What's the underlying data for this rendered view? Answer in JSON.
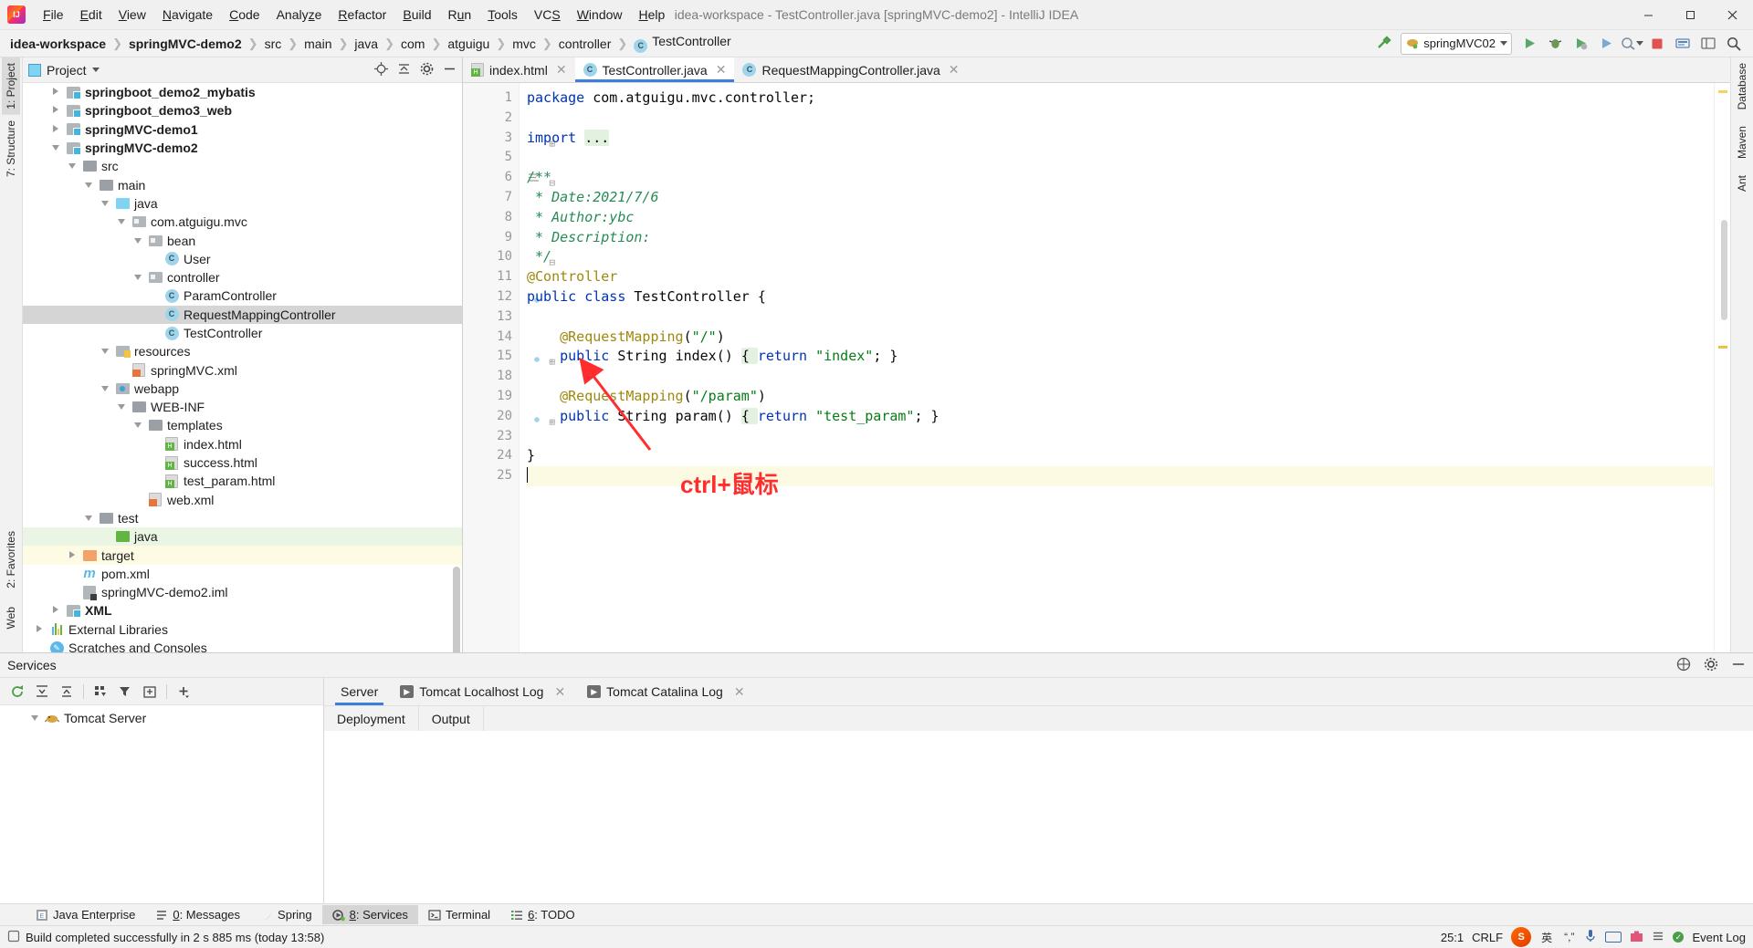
{
  "window": {
    "title": "idea-workspace - TestController.java [springMVC-demo2] - IntelliJ IDEA",
    "minimize": "—",
    "maximize": "❐",
    "close": "✕"
  },
  "menubar": [
    {
      "label": "File"
    },
    {
      "label": "Edit"
    },
    {
      "label": "View"
    },
    {
      "label": "Navigate"
    },
    {
      "label": "Code"
    },
    {
      "label": "Analyze"
    },
    {
      "label": "Refactor"
    },
    {
      "label": "Build"
    },
    {
      "label": "Run"
    },
    {
      "label": "Tools"
    },
    {
      "label": "VCS"
    },
    {
      "label": "Window"
    },
    {
      "label": "Help"
    }
  ],
  "breadcrumbs": [
    {
      "label": "idea-workspace",
      "bold": false
    },
    {
      "label": "springMVC-demo2",
      "bold": true
    },
    {
      "label": "src",
      "bold": false
    },
    {
      "label": "main",
      "bold": false
    },
    {
      "label": "java",
      "bold": false
    },
    {
      "label": "com",
      "bold": false
    },
    {
      "label": "atguigu",
      "bold": false
    },
    {
      "label": "mvc",
      "bold": false
    },
    {
      "label": "controller",
      "bold": false
    },
    {
      "label": "TestController",
      "bold": false,
      "icon": "class-icon"
    }
  ],
  "toolbar": {
    "build_hammer_icon": "hammer-icon",
    "run_config_name": "springMVC02",
    "run_icon": "run-icon",
    "debug_icon": "debug-icon",
    "coverage_icon": "coverage-icon",
    "profile_icon": "profile-icon",
    "attach_icon": "attach-icon",
    "stop_icon": "stop-icon",
    "updates_icon": "updates-icon",
    "layout_icon": "layout-icon",
    "search_icon": "search-icon"
  },
  "left_strip": [
    {
      "label": "1: Project",
      "selected": true,
      "name": "project-tool-tab"
    },
    {
      "label": "7: Structure",
      "selected": false,
      "name": "structure-tool-tab"
    },
    {
      "label": "2: Favorites",
      "selected": false,
      "name": "favorites-tool-tab"
    },
    {
      "label": "Web",
      "selected": false,
      "name": "web-tool-tab"
    }
  ],
  "right_strip": [
    {
      "label": "Database",
      "name": "database-tool-tab"
    },
    {
      "label": "Maven",
      "name": "maven-tool-tab"
    },
    {
      "label": "Ant",
      "name": "ant-tool-tab"
    }
  ],
  "project_panel": {
    "title": "Project",
    "dropdown_icon": "chevron-down-icon",
    "locate_icon": "locate-icon",
    "collapse_icon": "collapse-all-icon",
    "settings_icon": "gear-icon",
    "hide_icon": "hide-icon",
    "tree": [
      {
        "label": "springboot_demo2_mybatis",
        "indent": 1,
        "arrow": "right",
        "icon": "module-folder-icon",
        "bold": true,
        "state": "none"
      },
      {
        "label": "springboot_demo3_web",
        "indent": 1,
        "arrow": "right",
        "icon": "module-folder-icon",
        "bold": true,
        "state": "none"
      },
      {
        "label": "springMVC-demo1",
        "indent": 1,
        "arrow": "right",
        "icon": "module-folder-icon",
        "bold": true,
        "state": "none"
      },
      {
        "label": "springMVC-demo2",
        "indent": 1,
        "arrow": "down",
        "icon": "module-folder-icon",
        "bold": true,
        "state": "none"
      },
      {
        "label": "src",
        "indent": 2,
        "arrow": "down",
        "icon": "folder-grey-icon",
        "bold": false,
        "state": "none"
      },
      {
        "label": "main",
        "indent": 3,
        "arrow": "down",
        "icon": "folder-grey-icon",
        "bold": false,
        "state": "none"
      },
      {
        "label": "java",
        "indent": 4,
        "arrow": "down",
        "icon": "folder-blue-icon",
        "bold": false,
        "state": "none"
      },
      {
        "label": "com.atguigu.mvc",
        "indent": 5,
        "arrow": "down",
        "icon": "package-icon",
        "bold": false,
        "state": "none"
      },
      {
        "label": "bean",
        "indent": 6,
        "arrow": "down",
        "icon": "package-icon",
        "bold": false,
        "state": "none"
      },
      {
        "label": "User",
        "indent": 7,
        "arrow": "none",
        "icon": "class-icon",
        "bold": false,
        "state": "none"
      },
      {
        "label": "controller",
        "indent": 6,
        "arrow": "down",
        "icon": "package-icon",
        "bold": false,
        "state": "none"
      },
      {
        "label": "ParamController",
        "indent": 7,
        "arrow": "none",
        "icon": "class-icon",
        "bold": false,
        "state": "none"
      },
      {
        "label": "RequestMappingController",
        "indent": 7,
        "arrow": "none",
        "icon": "class-icon",
        "bold": false,
        "state": "selected"
      },
      {
        "label": "TestController",
        "indent": 7,
        "arrow": "none",
        "icon": "class-icon",
        "bold": false,
        "state": "none"
      },
      {
        "label": "resources",
        "indent": 4,
        "arrow": "down",
        "icon": "resources-folder-icon",
        "bold": false,
        "state": "none"
      },
      {
        "label": "springMVC.xml",
        "indent": 5,
        "arrow": "none",
        "icon": "xml-spring-file-icon",
        "bold": false,
        "state": "none"
      },
      {
        "label": "webapp",
        "indent": 4,
        "arrow": "down",
        "icon": "webapp-folder-icon",
        "bold": false,
        "state": "none"
      },
      {
        "label": "WEB-INF",
        "indent": 5,
        "arrow": "down",
        "icon": "folder-grey-icon",
        "bold": false,
        "state": "none"
      },
      {
        "label": "templates",
        "indent": 6,
        "arrow": "down",
        "icon": "folder-grey-icon",
        "bold": false,
        "state": "none"
      },
      {
        "label": "index.html",
        "indent": 7,
        "arrow": "none",
        "icon": "html-file-icon",
        "bold": false,
        "state": "none"
      },
      {
        "label": "success.html",
        "indent": 7,
        "arrow": "none",
        "icon": "html-file-icon",
        "bold": false,
        "state": "none"
      },
      {
        "label": "test_param.html",
        "indent": 7,
        "arrow": "none",
        "icon": "html-file-icon",
        "bold": false,
        "state": "none"
      },
      {
        "label": "web.xml",
        "indent": 6,
        "arrow": "none",
        "icon": "xml-file-icon",
        "bold": false,
        "state": "none"
      },
      {
        "label": "test",
        "indent": 3,
        "arrow": "down",
        "icon": "folder-grey-icon",
        "bold": false,
        "state": "none"
      },
      {
        "label": "java",
        "indent": 4,
        "arrow": "none",
        "icon": "folder-green-icon",
        "bold": false,
        "state": "green"
      },
      {
        "label": "target",
        "indent": 2,
        "arrow": "right",
        "icon": "folder-orange-icon",
        "bold": false,
        "state": "yellow"
      },
      {
        "label": "pom.xml",
        "indent": 2,
        "arrow": "none",
        "icon": "maven-file-icon",
        "bold": false,
        "state": "none"
      },
      {
        "label": "springMVC-demo2.iml",
        "indent": 2,
        "arrow": "none",
        "icon": "iml-file-icon",
        "bold": false,
        "state": "none"
      },
      {
        "label": "XML",
        "indent": 1,
        "arrow": "right",
        "icon": "module-folder-icon",
        "bold": true,
        "state": "none"
      },
      {
        "label": "External Libraries",
        "indent": 0,
        "arrow": "right",
        "icon": "libraries-icon",
        "bold": false,
        "state": "none"
      },
      {
        "label": "Scratches and Consoles",
        "indent": 0,
        "arrow": "none",
        "icon": "scratches-icon",
        "bold": false,
        "state": "none"
      }
    ]
  },
  "editor": {
    "tabs": [
      {
        "label": "index.html",
        "icon": "html-file-icon",
        "active": false,
        "close": "✕"
      },
      {
        "label": "TestController.java",
        "icon": "class-icon",
        "active": true,
        "close": "✕"
      },
      {
        "label": "RequestMappingController.java",
        "icon": "class-icon",
        "active": false,
        "close": "✕"
      }
    ],
    "line_numbers": [
      "1",
      "2",
      "3",
      "5",
      "6",
      "7",
      "8",
      "9",
      "10",
      "11",
      "12",
      "13",
      "14",
      "15",
      "18",
      "19",
      "20",
      "23",
      "24",
      "25"
    ],
    "lines": [
      {
        "n": "1",
        "tokens": [
          {
            "t": "package",
            "c": "kw"
          },
          {
            "t": " com.atguigu.mvc.controller;",
            "c": "plain"
          }
        ]
      },
      {
        "n": "2",
        "tokens": []
      },
      {
        "n": "3",
        "tokens": [
          {
            "t": "import",
            "c": "kw"
          },
          {
            "t": " ",
            "c": "plain"
          },
          {
            "t": "...",
            "c": "fold"
          }
        ]
      },
      {
        "n": "5",
        "tokens": []
      },
      {
        "n": "6",
        "tokens": [
          {
            "t": "/**",
            "c": "cmt"
          }
        ]
      },
      {
        "n": "7",
        "tokens": [
          {
            "t": " * Date:2021/7/6",
            "c": "cmt"
          }
        ]
      },
      {
        "n": "8",
        "tokens": [
          {
            "t": " * Author:ybc",
            "c": "cmt"
          }
        ]
      },
      {
        "n": "9",
        "tokens": [
          {
            "t": " * Description:",
            "c": "cmt"
          }
        ]
      },
      {
        "n": "10",
        "tokens": [
          {
            "t": " */",
            "c": "cmt"
          }
        ]
      },
      {
        "n": "11",
        "tokens": [
          {
            "t": "@Controller",
            "c": "ann"
          }
        ]
      },
      {
        "n": "12",
        "tokens": [
          {
            "t": "public class",
            "c": "kw"
          },
          {
            "t": " TestController {",
            "c": "plain"
          }
        ]
      },
      {
        "n": "13",
        "tokens": []
      },
      {
        "n": "14",
        "tokens": [
          {
            "t": "    @RequestMapping",
            "c": "ann"
          },
          {
            "t": "(",
            "c": "plain"
          },
          {
            "t": "\"/\"",
            "c": "str"
          },
          {
            "t": ")",
            "c": "plain"
          }
        ]
      },
      {
        "n": "15",
        "tokens": [
          {
            "t": "    public",
            "c": "kw"
          },
          {
            "t": " String ",
            "c": "plain"
          },
          {
            "t": "index",
            "c": "mth"
          },
          {
            "t": "() ",
            "c": "plain"
          },
          {
            "t": "{ ",
            "c": "fold"
          },
          {
            "t": "return",
            "c": "kw"
          },
          {
            "t": " ",
            "c": "plain"
          },
          {
            "t": "\"index\"",
            "c": "str"
          },
          {
            "t": "; }",
            "c": "plain"
          }
        ]
      },
      {
        "n": "18",
        "tokens": []
      },
      {
        "n": "19",
        "tokens": [
          {
            "t": "    @RequestMapping",
            "c": "ann"
          },
          {
            "t": "(",
            "c": "plain"
          },
          {
            "t": "\"/param\"",
            "c": "str"
          },
          {
            "t": ")",
            "c": "plain"
          }
        ]
      },
      {
        "n": "20",
        "tokens": [
          {
            "t": "    public",
            "c": "kw"
          },
          {
            "t": " String ",
            "c": "plain"
          },
          {
            "t": "param",
            "c": "mth"
          },
          {
            "t": "() ",
            "c": "plain"
          },
          {
            "t": "{ ",
            "c": "fold"
          },
          {
            "t": "return",
            "c": "kw"
          },
          {
            "t": " ",
            "c": "plain"
          },
          {
            "t": "\"test_param\"",
            "c": "str"
          },
          {
            "t": "; }",
            "c": "plain"
          }
        ]
      },
      {
        "n": "23",
        "tokens": []
      },
      {
        "n": "24",
        "tokens": [
          {
            "t": "}",
            "c": "plain"
          }
        ]
      },
      {
        "n": "25",
        "tokens": [],
        "cursor": true
      }
    ],
    "annotation_text": "ctrl+鼠标",
    "annotation_arrow_icon": "red-arrow-icon"
  },
  "services": {
    "title": "Services",
    "settings_icon": "gear-icon",
    "help_icon": "help-icon",
    "hide_icon": "hide-icon",
    "toolbar_icons": [
      "rerun-icon",
      "expand-all-icon",
      "collapse-all-icon",
      "group-icon",
      "filter-icon",
      "add-frame-icon",
      "add-icon"
    ],
    "tree": [
      {
        "label": "Tomcat Server",
        "arrow": "down",
        "icon": "tomcat-icon"
      }
    ],
    "tabs": [
      {
        "label": "Server",
        "active": true,
        "icon": null,
        "close": null
      },
      {
        "label": "Tomcat Localhost Log",
        "active": false,
        "icon": "console-icon",
        "close": "✕"
      },
      {
        "label": "Tomcat Catalina Log",
        "active": false,
        "icon": "console-icon",
        "close": "✕"
      }
    ],
    "subtabs": [
      {
        "label": "Deployment"
      },
      {
        "label": "Output"
      }
    ]
  },
  "bottom_tabs": [
    {
      "label": "Java Enterprise",
      "icon": "java-ee-icon",
      "selected": false,
      "mnemonic": ""
    },
    {
      "label": "0: Messages",
      "icon": "messages-icon",
      "selected": false,
      "mnemonic": "0"
    },
    {
      "label": "Spring",
      "icon": "spring-icon",
      "selected": false,
      "mnemonic": ""
    },
    {
      "label": "8: Services",
      "icon": "services-icon",
      "selected": true,
      "mnemonic": "8"
    },
    {
      "label": "Terminal",
      "icon": "terminal-icon",
      "selected": false,
      "mnemonic": ""
    },
    {
      "label": "6: TODO",
      "icon": "todo-icon",
      "selected": false,
      "mnemonic": "6"
    }
  ],
  "statusbar": {
    "icon": "build-icon",
    "message": "Build completed successfully in 2 s 885 ms (today 13:58)",
    "caret_position": "25:1",
    "line_separator": "CRLF",
    "ime_lang": "英",
    "ime_punct": "“,”",
    "event_log": "Event Log",
    "sogou_icon": "sogou-icon",
    "mic_icon": "mic-icon",
    "keyboard_icon": "keyboard-icon",
    "toolbox_icon": "toolbox-icon",
    "menu_icon": "menu-icon"
  },
  "colors": {
    "accent_blue": "#3d7ddc",
    "selection_grey": "#d5d5d5",
    "green_highlight": "#eaf5e4",
    "yellow_highlight": "#fdfbe4",
    "annotation_red": "#ff2d2d",
    "keyword_blue": "#0033b3",
    "string_green": "#067d17",
    "comment_green": "#268c56",
    "annotation_yellow": "#9e880d"
  }
}
